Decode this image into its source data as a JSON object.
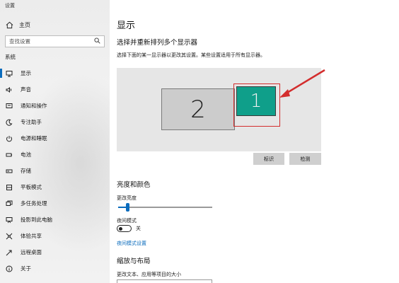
{
  "window": {
    "title": "设置"
  },
  "sidebar": {
    "home_label": "主页",
    "search": {
      "placeholder": "查找设置"
    },
    "section_title": "系统",
    "items": [
      {
        "label": "显示",
        "icon": "monitor-icon"
      },
      {
        "label": "声音",
        "icon": "speaker-icon"
      },
      {
        "label": "通知和操作",
        "icon": "notification-icon"
      },
      {
        "label": "专注助手",
        "icon": "moon-icon"
      },
      {
        "label": "电源和睡眠",
        "icon": "power-icon"
      },
      {
        "label": "电池",
        "icon": "battery-icon"
      },
      {
        "label": "存储",
        "icon": "storage-icon"
      },
      {
        "label": "平板模式",
        "icon": "tablet-icon"
      },
      {
        "label": "多任务处理",
        "icon": "multitask-icon"
      },
      {
        "label": "投影到此电脑",
        "icon": "projector-icon"
      },
      {
        "label": "体验共享",
        "icon": "share-icon"
      },
      {
        "label": "远程桌面",
        "icon": "remote-icon"
      },
      {
        "label": "关于",
        "icon": "info-icon"
      }
    ],
    "active_index": 0
  },
  "main": {
    "page_title": "显示",
    "arrange_title": "选择并重新排列多个显示器",
    "arrange_desc": "选择下面的某一显示器以更改其设置。某些设置适用于所有显示器。",
    "monitors": [
      {
        "number": "2",
        "selected": false
      },
      {
        "number": "1",
        "selected": true
      }
    ],
    "identify_label": "标识",
    "detect_label": "检测",
    "brightness_section": "亮度和颜色",
    "brightness_label": "更改亮度",
    "brightness_level": 0.1,
    "night_light_label": "夜间模式",
    "night_light_state": "关",
    "night_light_link": "夜间模式设置",
    "scale_section": "缩放与布局",
    "scale_label": "更改文本、应用等项目的大小"
  },
  "colors": {
    "accent": "#0b6cbd",
    "selected_monitor": "#0f9f8a",
    "annotation": "#d32d2d"
  }
}
